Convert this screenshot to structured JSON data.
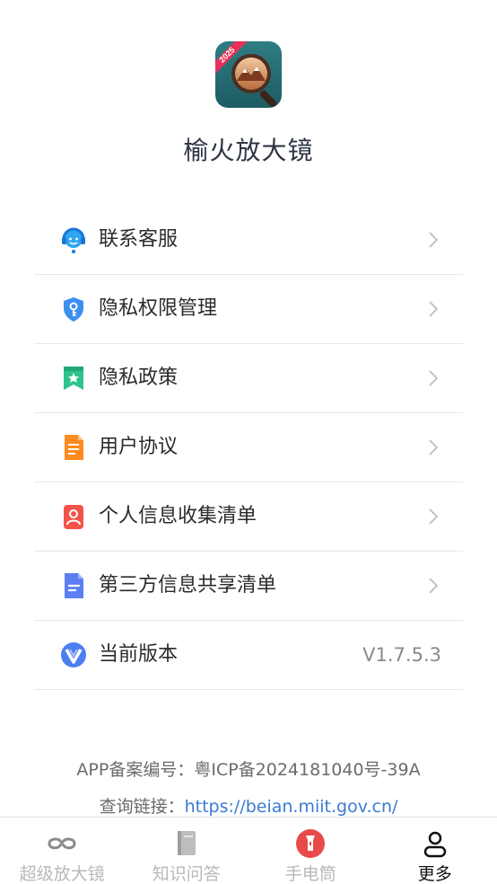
{
  "app": {
    "name": "榆火放大镜",
    "logo_badge": "2025"
  },
  "menu": [
    {
      "label": "联系客服",
      "icon": "customer-service-icon"
    },
    {
      "label": "隐私权限管理",
      "icon": "shield-key-icon"
    },
    {
      "label": "隐私政策",
      "icon": "bookmark-star-icon"
    },
    {
      "label": "用户协议",
      "icon": "document-icon"
    },
    {
      "label": "个人信息收集清单",
      "icon": "person-card-icon"
    },
    {
      "label": "第三方信息共享清单",
      "icon": "file-lines-icon"
    },
    {
      "label": "当前版本",
      "icon": "v-logo-icon",
      "value": "V1.7.5.3"
    }
  ],
  "footer": {
    "record": "APP备案编号：粤ICP备2024181040号-39A",
    "query_prefix": "查询链接：",
    "query_link": "https://beian.miit.gov.cn/"
  },
  "tabs": [
    {
      "label": "超级放大镜",
      "icon": "glasses-icon",
      "active": false
    },
    {
      "label": "知识问答",
      "icon": "book-icon",
      "active": false
    },
    {
      "label": "手电筒",
      "icon": "flashlight-icon",
      "active": false
    },
    {
      "label": "更多",
      "icon": "user-icon",
      "active": true
    }
  ],
  "colors": {
    "accent_link": "#3a7bd5",
    "flashlight_red": "#e84a4a"
  }
}
